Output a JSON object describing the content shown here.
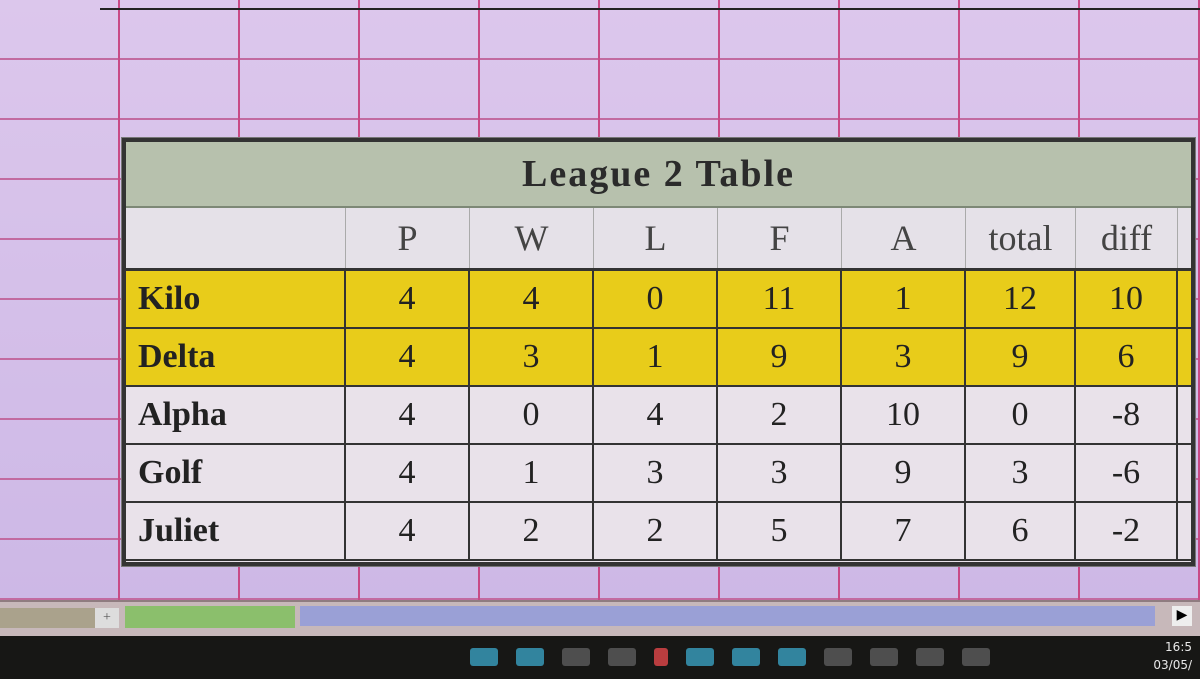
{
  "table": {
    "title": "League 2 Table",
    "columns": [
      "",
      "P",
      "W",
      "L",
      "F",
      "A",
      "total",
      "diff"
    ],
    "rows": [
      {
        "team": "Kilo",
        "P": "4",
        "W": "4",
        "L": "0",
        "F": "11",
        "A": "1",
        "total": "12",
        "diff": "10",
        "highlight": true
      },
      {
        "team": "Delta",
        "P": "4",
        "W": "3",
        "L": "1",
        "F": "9",
        "A": "3",
        "total": "9",
        "diff": "6",
        "highlight": true
      },
      {
        "team": "Alpha",
        "P": "4",
        "W": "0",
        "L": "4",
        "F": "2",
        "A": "10",
        "total": "0",
        "diff": "-8",
        "highlight": false
      },
      {
        "team": "Golf",
        "P": "4",
        "W": "1",
        "L": "3",
        "F": "3",
        "A": "9",
        "total": "3",
        "diff": "-6",
        "highlight": false
      },
      {
        "team": "Juliet",
        "P": "4",
        "W": "2",
        "L": "2",
        "F": "5",
        "A": "7",
        "total": "6",
        "diff": "-2",
        "highlight": false
      }
    ]
  },
  "taskbar": {
    "time": "16:5",
    "date": "03/05/"
  },
  "colors": {
    "highlight": "#e8cc1a",
    "title_bg": "#b7c1ad"
  }
}
